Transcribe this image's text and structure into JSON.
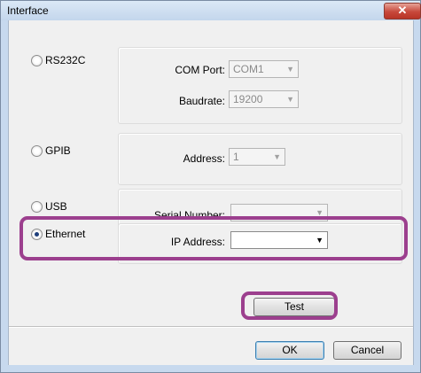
{
  "window": {
    "title": "Interface",
    "close_glyph": "✕"
  },
  "rs232c": {
    "label": "RS232C",
    "com_port_label": "COM Port:",
    "com_port_value": "COM1",
    "baudrate_label": "Baudrate:",
    "baudrate_value": "19200"
  },
  "gpib": {
    "label": "GPIB",
    "address_label": "Address:",
    "address_value": "1"
  },
  "usb": {
    "label": "USB",
    "serial_label": "Serial Number:",
    "serial_value": ""
  },
  "ethernet": {
    "label": "Ethernet",
    "selected": true,
    "ip_label": "IP Address:",
    "ip_value": ""
  },
  "buttons": {
    "test": "Test",
    "ok": "OK",
    "cancel": "Cancel"
  },
  "colors": {
    "highlight": "#9c3f8e",
    "close": "#c7483b"
  }
}
